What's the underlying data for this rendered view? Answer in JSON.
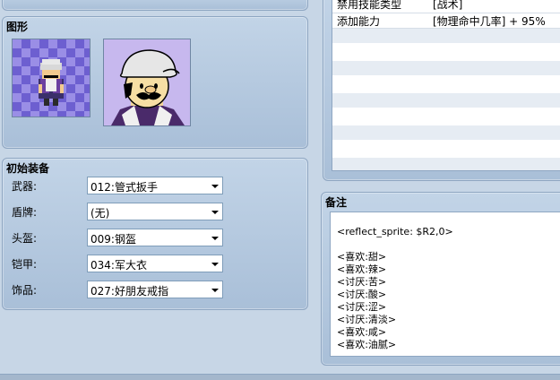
{
  "graphic": {
    "title": "图形"
  },
  "equipment": {
    "title": "初始装备",
    "rows": [
      {
        "label": "武器:",
        "value": "012:管式扳手"
      },
      {
        "label": "盾牌:",
        "value": "(无)"
      },
      {
        "label": "头盔:",
        "value": "009:钢盔"
      },
      {
        "label": "铠甲:",
        "value": "034:军大衣"
      },
      {
        "label": "饰品:",
        "value": "027:好朋友戒指"
      }
    ]
  },
  "traits": {
    "rows": [
      {
        "type": "禁用技能类型",
        "content": "[战术]"
      },
      {
        "type": "添加能力",
        "content": "[物理命中几率] + 95%"
      }
    ]
  },
  "note": {
    "title": "备注",
    "lines": [
      "<reflect_sprite: $R2,0>",
      "",
      "<喜欢:甜>",
      "<喜欢:辣>",
      "<讨厌:苦>",
      "<讨厌:酸>",
      "<讨厌:涩>",
      "<讨厌:清淡>",
      "<喜欢:咸>",
      "<喜欢:油腻>"
    ]
  }
}
